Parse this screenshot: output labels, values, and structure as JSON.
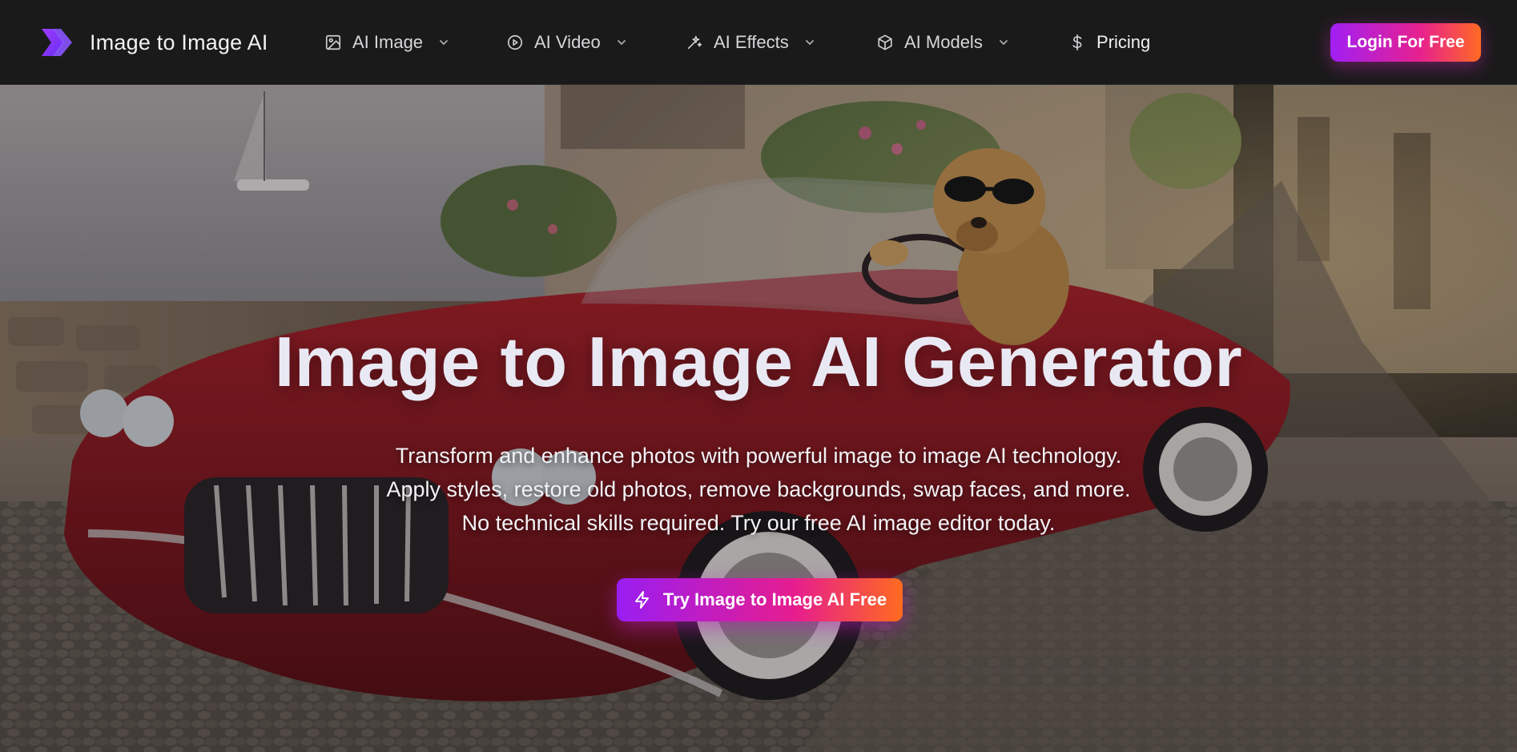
{
  "header": {
    "brand_name": "Image to Image AI",
    "nav_items": [
      {
        "label": "AI Image",
        "icon": "image-icon",
        "has_dropdown": true
      },
      {
        "label": "AI Video",
        "icon": "play-circle-icon",
        "has_dropdown": true
      },
      {
        "label": "AI Effects",
        "icon": "magic-wand-icon",
        "has_dropdown": true
      },
      {
        "label": "AI Models",
        "icon": "cube-icon",
        "has_dropdown": true
      },
      {
        "label": "Pricing",
        "icon": "dollar-icon",
        "has_dropdown": false
      }
    ],
    "login_label": "Login For Free"
  },
  "hero": {
    "title": "Image to Image AI Generator",
    "subtitle_lines": [
      "Transform and enhance photos with powerful image to image AI technology.",
      "Apply styles, restore old photos, remove backgrounds, swap faces, and more.",
      "No technical skills required. Try our free AI image editor today."
    ],
    "cta_label": "Try Image to Image AI Free",
    "cta_icon": "lightning-icon"
  },
  "colors": {
    "nav_background": "#1a1a1a",
    "brand_gradient_start": "#a11ff5",
    "brand_gradient_mid": "#e7218e",
    "brand_gradient_end": "#ff6a23",
    "logo_color": "#7b3cff"
  }
}
